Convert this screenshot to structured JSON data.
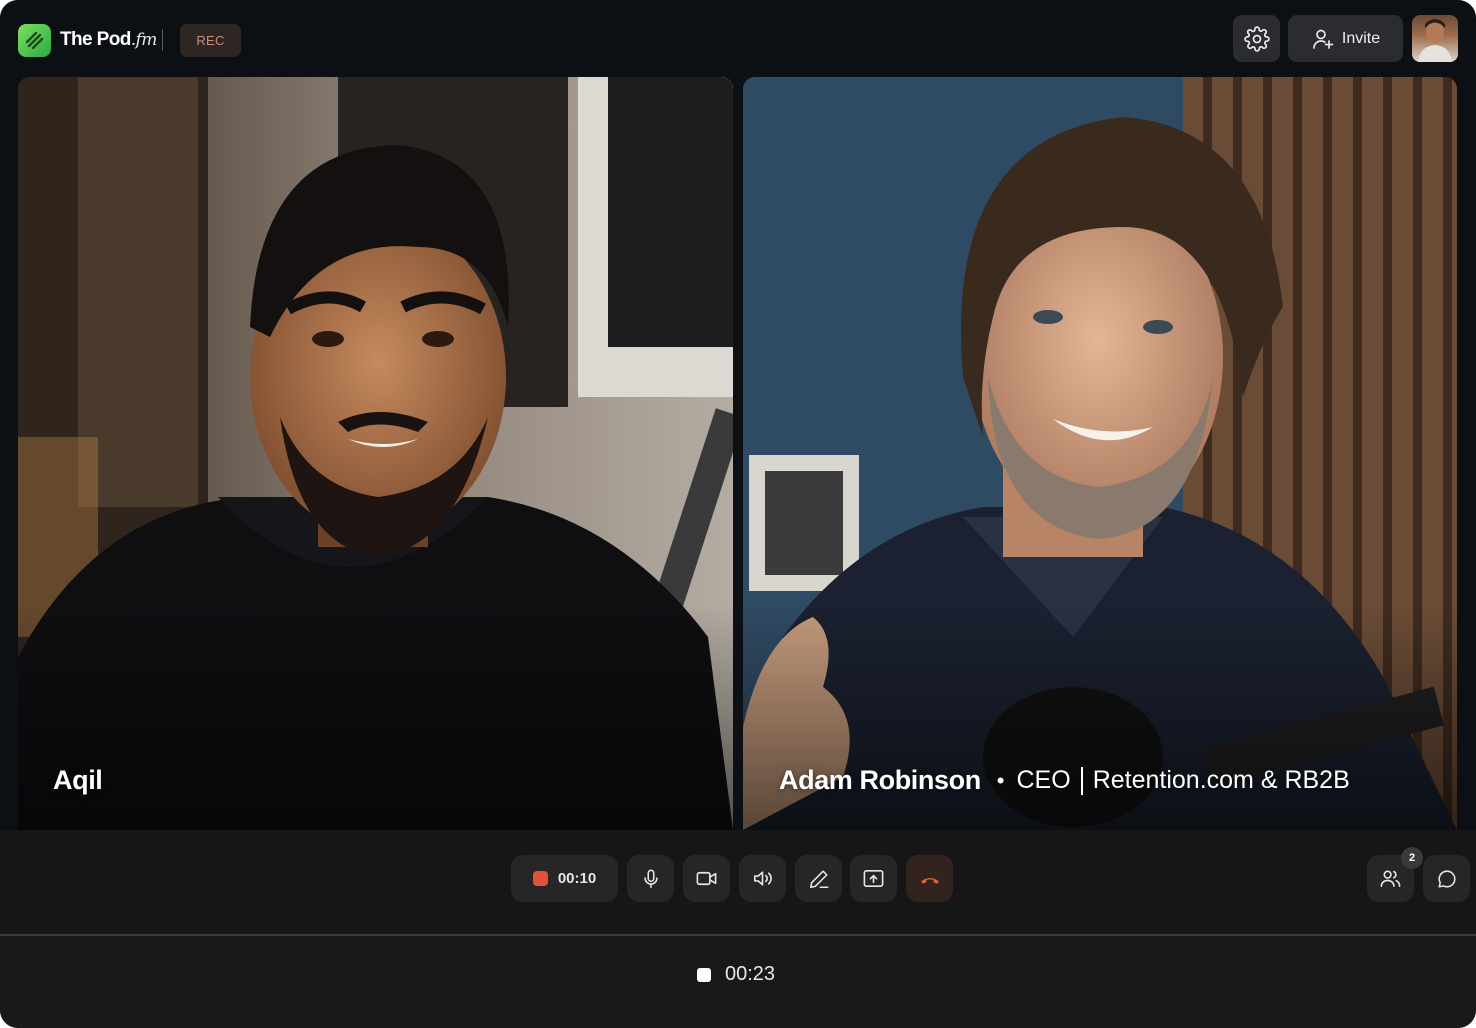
{
  "header": {
    "brand_name": "The Pod",
    "brand_suffix": ".fm",
    "rec_label": "REC",
    "invite_label": "Invite"
  },
  "participants": [
    {
      "name": "Aqil"
    },
    {
      "name": "Adam Robinson",
      "role": "CEO",
      "company": "Retention.com & RB2B"
    }
  ],
  "controls": {
    "timer": "00:10",
    "participants_count": "2",
    "icons": [
      "record-icon",
      "microphone-icon",
      "camera-icon",
      "speaker-icon",
      "pen-icon",
      "share-screen-icon",
      "end-call-icon",
      "participants-icon",
      "chat-icon"
    ]
  },
  "recording": {
    "elapsed": "00:23"
  },
  "colors": {
    "background": "#0c0f13",
    "accent_green": "#4cc75a",
    "record_red": "#e0523b",
    "end_call": "#e3603f"
  }
}
